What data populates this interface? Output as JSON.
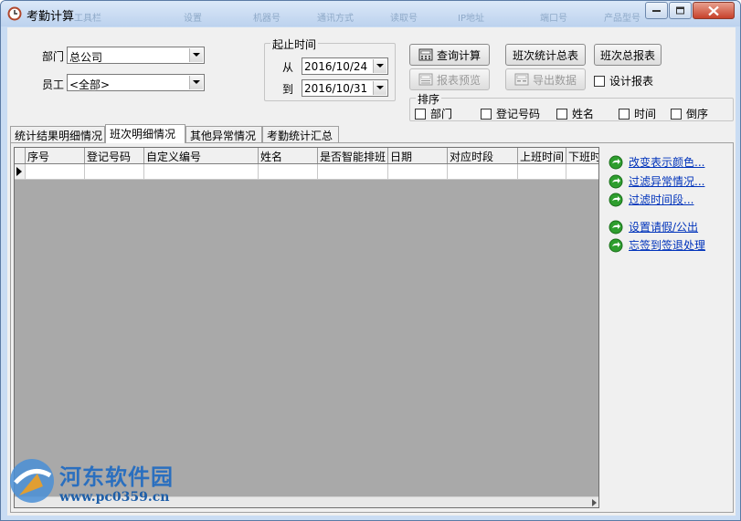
{
  "window": {
    "title": "考勤计算",
    "ghost_title_fragments": [
      "工具栏",
      "设置",
      "机器号",
      "通讯方式",
      "读取号",
      "IP地址",
      "端口号",
      "产品型号"
    ]
  },
  "filters": {
    "department_label": "部门",
    "department_value": "总公司",
    "employee_label": "员工",
    "employee_value": "<全部>"
  },
  "date_range": {
    "group_title": "起止时间",
    "from_label": "从",
    "from_value": "2016/10/24",
    "to_label": "到",
    "to_value": "2016/10/31"
  },
  "buttons": {
    "query": "查询计算",
    "shift_summary": "班次统计总表",
    "shift_total": "班次总报表",
    "preview": "报表预览",
    "export": "导出数据",
    "design_report": "设计报表"
  },
  "sort": {
    "group_title": "排序",
    "options": [
      "部门",
      "登记号码",
      "姓名",
      "时间",
      "倒序"
    ]
  },
  "tabs": [
    "统计结果明细情况",
    "班次明细情况",
    "其他异常情况",
    "考勤统计汇总"
  ],
  "active_tab": 1,
  "grid": {
    "columns": [
      "序号",
      "登记号码",
      "自定义编号",
      "姓名",
      "是否智能排班",
      "日期",
      "对应时段",
      "上班时间",
      "下班时"
    ]
  },
  "side_links": [
    "改变表示颜色...",
    "过滤异常情况...",
    "过滤时间段...",
    "设置请假/公出",
    "忘签到签退处理"
  ],
  "watermark": {
    "title": "河东软件园",
    "url": "www.pc0359.cn"
  },
  "colors": {
    "link": "#0033bb",
    "window_frame": "#c9dcf3",
    "watermark_blue": "#2a6fbf",
    "go_icon_green": "#2e9e2e"
  },
  "icons": {
    "title": "app-clock-icon",
    "query": "calculator-icon",
    "preview": "report-preview-icon",
    "export": "export-data-icon",
    "link": "green-go-arrow-icon"
  }
}
